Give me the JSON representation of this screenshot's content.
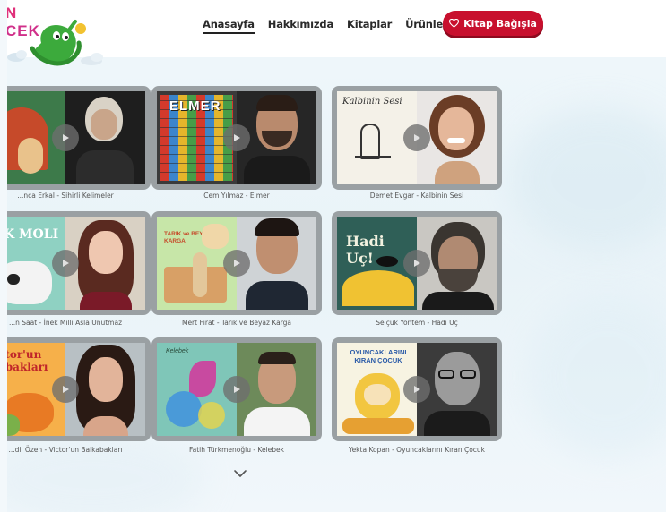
{
  "logo": {
    "line1": "N",
    "line2": "CEK"
  },
  "nav": {
    "items": [
      {
        "label": "Anasayfa",
        "active": true
      },
      {
        "label": "Hakkımızda",
        "active": false
      },
      {
        "label": "Kitaplar",
        "active": false
      },
      {
        "label": "Ürünler",
        "active": false
      }
    ],
    "donate_label": "Kitap Bağışla"
  },
  "cards": [
    {
      "caption": "...nca Erkal - Sihirli Kelimeler",
      "cover_title": "",
      "cover_color": "#3d7a4a",
      "face_bg": "#1e1e1e"
    },
    {
      "caption": "Cem Yılmaz - Elmer",
      "cover_title": "ELMER",
      "cover_color": "#d94b2a",
      "face_bg": "#262626"
    },
    {
      "caption": "Demet Evgar - Kalbinin Sesi",
      "cover_title": "Kalbinin Sesi",
      "cover_color": "#f4f1e8",
      "face_bg": "#e9e6e4"
    },
    {
      "caption": "...n Saat - İnek Milli Asla Unutmaz",
      "cover_title": "K MOLI",
      "cover_color": "#8fd1c2",
      "face_bg": "#d9d1c4"
    },
    {
      "caption": "Mert Fırat - Tarık ve Beyaz Karga",
      "cover_title": "TARIK ve BEYAZ KARGA",
      "cover_color": "#c7e6a8",
      "face_bg": "#cfd3d6"
    },
    {
      "caption": "Selçuk Yöntem - Hadi Uç",
      "cover_title": "Hadi Uç!",
      "cover_color": "#2f5f57",
      "face_bg": "#c9c7c2"
    },
    {
      "caption": "...dil Özen - Victor'un Balkabakları",
      "cover_title": "ctor'un abakları",
      "cover_color": "#f6b04a",
      "face_bg": "#b8c0c4"
    },
    {
      "caption": "Fatih Türkmenoğlu - Kelebek",
      "cover_title": "Kelebek",
      "cover_color": "#7fc6b8",
      "face_bg": "#6d8a5a"
    },
    {
      "caption": "Yekta Kopan - Oyuncaklarını Kıran Çocuk",
      "cover_title": "OYUNCAKLARINI KIRAN ÇOCUK",
      "cover_color": "#f7f3e2",
      "face_bg": "#3b3b3b"
    }
  ],
  "icons": {
    "donate": "heart-outline-icon",
    "play": "play-icon",
    "scroll": "chevron-down-icon"
  },
  "colors": {
    "brand_red": "#c8102e",
    "logo_pink": "#e0307a",
    "mascot_green": "#3caa3c"
  }
}
